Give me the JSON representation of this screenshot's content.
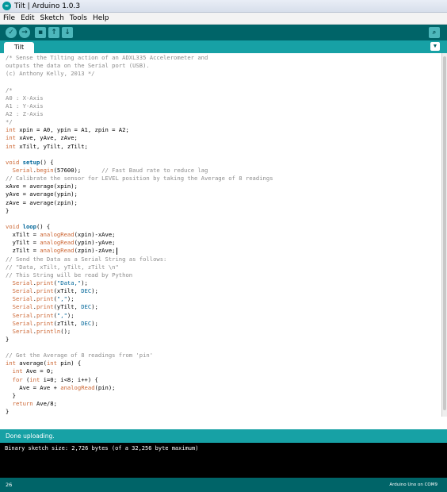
{
  "window": {
    "title": "Tilt | Arduino 1.0.3",
    "icon": "arduino-logo-icon"
  },
  "menu": [
    "File",
    "Edit",
    "Sketch",
    "Tools",
    "Help"
  ],
  "toolbar": {
    "buttons": [
      {
        "name": "verify",
        "glyph": "✓"
      },
      {
        "name": "upload",
        "glyph": "→"
      },
      {
        "name": "new",
        "glyph": "▪"
      },
      {
        "name": "open",
        "glyph": "↑"
      },
      {
        "name": "save",
        "glyph": "↓"
      }
    ],
    "serial_monitor_glyph": "⌕"
  },
  "tabs": {
    "active": "Tilt",
    "menu_glyph": "▼"
  },
  "code": [
    [
      [
        "c",
        "/* Sense the Tilting action of an ADXL335 Accelerometer and"
      ]
    ],
    [
      [
        "c",
        "outputs the data on the Serial port (USB)."
      ]
    ],
    [
      [
        "c",
        "(c) Anthony Kelly, 2013 */"
      ]
    ],
    [],
    [
      [
        "c",
        "/*"
      ]
    ],
    [
      [
        "c",
        "A0 : X-Axis"
      ]
    ],
    [
      [
        "c",
        "A1 : Y-Axis"
      ]
    ],
    [
      [
        "c",
        "A2 : Z-Axis"
      ]
    ],
    [
      [
        "c",
        "*/"
      ]
    ],
    [
      [
        "k",
        "int"
      ],
      [
        "p",
        " xpin = A0, ypin = A1, zpin = A2;"
      ]
    ],
    [
      [
        "k",
        "int"
      ],
      [
        "p",
        " xAve, yAve, zAve;"
      ]
    ],
    [
      [
        "k",
        "int"
      ],
      [
        "p",
        " xTilt, yTilt, zTilt;"
      ]
    ],
    [],
    [
      [
        "k",
        "void"
      ],
      [
        "p",
        " "
      ],
      [
        "f",
        "setup"
      ],
      [
        "p",
        "() {"
      ]
    ],
    [
      [
        "p",
        "  "
      ],
      [
        "fl",
        "Serial"
      ],
      [
        "p",
        "."
      ],
      [
        "fl",
        "begin"
      ],
      [
        "p",
        "(57600);      "
      ],
      [
        "c",
        "// Fast Baud rate to reduce lag"
      ]
    ],
    [
      [
        "c",
        "// Calibrate the sensor for LEVEL position by taking the Average of 8 readings"
      ]
    ],
    [
      [
        "p",
        "xAve = average(xpin);"
      ]
    ],
    [
      [
        "p",
        "yAve = average(ypin);"
      ]
    ],
    [
      [
        "p",
        "zAve = average(zpin);"
      ]
    ],
    [
      [
        "p",
        "}"
      ]
    ],
    [],
    [
      [
        "k",
        "void"
      ],
      [
        "p",
        " "
      ],
      [
        "f",
        "loop"
      ],
      [
        "p",
        "() {"
      ]
    ],
    [
      [
        "p",
        "  xTilt = "
      ],
      [
        "fl",
        "analogRead"
      ],
      [
        "p",
        "(xpin)-xAve;"
      ]
    ],
    [
      [
        "p",
        "  yTilt = "
      ],
      [
        "fl",
        "analogRead"
      ],
      [
        "p",
        "(ypin)-yAve;"
      ]
    ],
    [
      [
        "p",
        "  zTilt = "
      ],
      [
        "fl",
        "analogRead"
      ],
      [
        "p",
        "(zpin)-zAve;"
      ],
      [
        "caret",
        ""
      ]
    ],
    [
      [
        "c",
        "// Send the Data as a Serial String as follows:"
      ]
    ],
    [
      [
        "c",
        "// \"Data, xTilt, yTilt, zTilt \\n\""
      ]
    ],
    [
      [
        "c",
        "// This String will be read by Python"
      ]
    ],
    [
      [
        "p",
        "  "
      ],
      [
        "fl",
        "Serial"
      ],
      [
        "p",
        "."
      ],
      [
        "fl",
        "print"
      ],
      [
        "p",
        "("
      ],
      [
        "s",
        "\"Data,\""
      ],
      [
        "p",
        ");"
      ]
    ],
    [
      [
        "p",
        "  "
      ],
      [
        "fl",
        "Serial"
      ],
      [
        "p",
        "."
      ],
      [
        "fl",
        "print"
      ],
      [
        "p",
        "(xTilt, "
      ],
      [
        "s",
        "DEC"
      ],
      [
        "p",
        ");"
      ]
    ],
    [
      [
        "p",
        "  "
      ],
      [
        "fl",
        "Serial"
      ],
      [
        "p",
        "."
      ],
      [
        "fl",
        "print"
      ],
      [
        "p",
        "("
      ],
      [
        "s",
        "\",\""
      ],
      [
        "p",
        ");"
      ]
    ],
    [
      [
        "p",
        "  "
      ],
      [
        "fl",
        "Serial"
      ],
      [
        "p",
        "."
      ],
      [
        "fl",
        "print"
      ],
      [
        "p",
        "(yTilt, "
      ],
      [
        "s",
        "DEC"
      ],
      [
        "p",
        ");"
      ]
    ],
    [
      [
        "p",
        "  "
      ],
      [
        "fl",
        "Serial"
      ],
      [
        "p",
        "."
      ],
      [
        "fl",
        "print"
      ],
      [
        "p",
        "("
      ],
      [
        "s",
        "\",\""
      ],
      [
        "p",
        ");"
      ]
    ],
    [
      [
        "p",
        "  "
      ],
      [
        "fl",
        "Serial"
      ],
      [
        "p",
        "."
      ],
      [
        "fl",
        "print"
      ],
      [
        "p",
        "(zTilt, "
      ],
      [
        "s",
        "DEC"
      ],
      [
        "p",
        ");"
      ]
    ],
    [
      [
        "p",
        "  "
      ],
      [
        "fl",
        "Serial"
      ],
      [
        "p",
        "."
      ],
      [
        "fl",
        "println"
      ],
      [
        "p",
        "();"
      ]
    ],
    [
      [
        "p",
        "}"
      ]
    ],
    [],
    [
      [
        "c",
        "// Get the Average of 8 readings from 'pin'"
      ]
    ],
    [
      [
        "k",
        "int"
      ],
      [
        "p",
        " average("
      ],
      [
        "k",
        "int"
      ],
      [
        "p",
        " pin) {"
      ]
    ],
    [
      [
        "p",
        "  "
      ],
      [
        "k",
        "int"
      ],
      [
        "p",
        " Ave = 0;"
      ]
    ],
    [
      [
        "p",
        "  "
      ],
      [
        "k",
        "for"
      ],
      [
        "p",
        " ("
      ],
      [
        "k",
        "int"
      ],
      [
        "p",
        " i=0; i<8; i++) {"
      ]
    ],
    [
      [
        "p",
        "    Ave = Ave + "
      ],
      [
        "fl",
        "analogRead"
      ],
      [
        "p",
        "(pin);"
      ]
    ],
    [
      [
        "p",
        "  }"
      ]
    ],
    [
      [
        "p",
        "  "
      ],
      [
        "k",
        "return"
      ],
      [
        "p",
        " Ave/8;"
      ]
    ],
    [
      [
        "p",
        "}"
      ]
    ]
  ],
  "status": {
    "message": "Done uploading."
  },
  "console": {
    "text": "Binary sketch size: 2,726 bytes (of a 32,256 byte maximum)"
  },
  "footer": {
    "line_number": "26",
    "board": "Arduino Uno on COM9"
  }
}
